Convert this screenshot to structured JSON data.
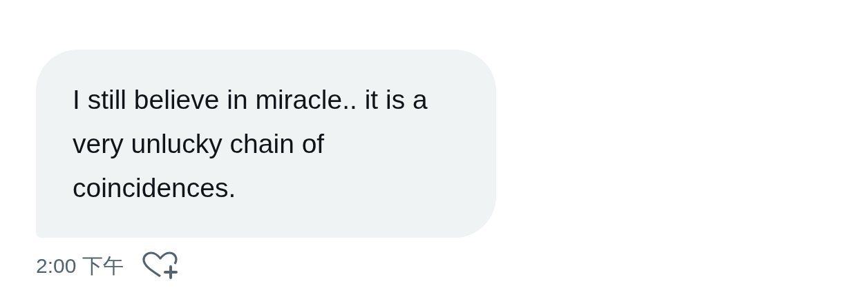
{
  "message": {
    "text": "I still believe in miracle.. it is a very unlucky chain of coincidences.",
    "time": "2:00 下午"
  }
}
